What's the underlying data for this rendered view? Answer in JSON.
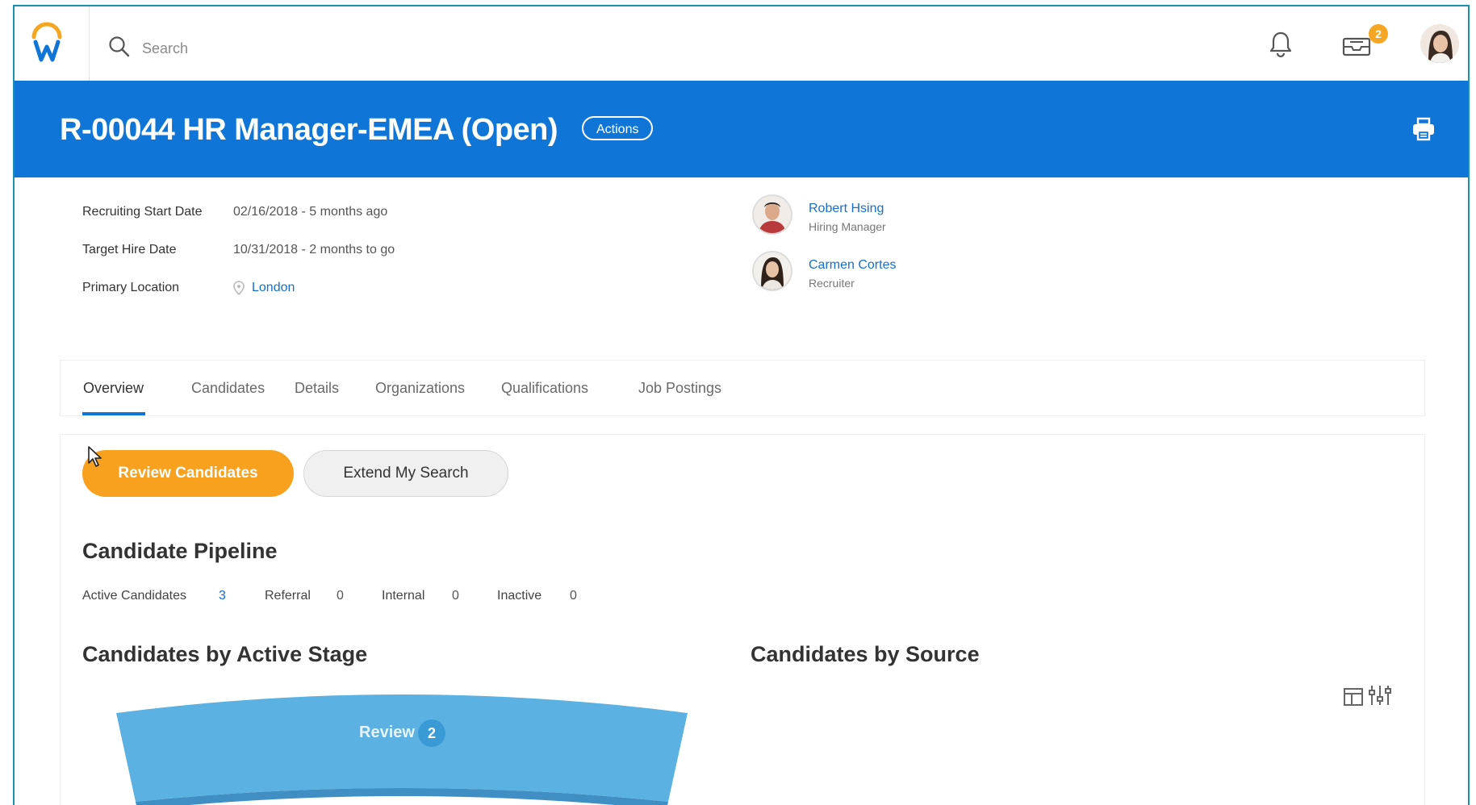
{
  "topbar": {
    "search_placeholder": "Search",
    "inbox_badge": "2"
  },
  "header": {
    "title": "R-00044 HR Manager-EMEA (Open)",
    "actions_label": "Actions"
  },
  "info": {
    "rows": [
      {
        "label": "Recruiting Start Date",
        "value": "02/16/2018 - 5 months ago"
      },
      {
        "label": "Target Hire Date",
        "value": "10/31/2018 - 2 months to go"
      },
      {
        "label": "Primary Location",
        "value": "London"
      }
    ],
    "people": [
      {
        "name": "Robert Hsing",
        "role": "Hiring Manager"
      },
      {
        "name": "Carmen Cortes",
        "role": "Recruiter"
      }
    ]
  },
  "tabs": [
    "Overview",
    "Candidates",
    "Details",
    "Organizations",
    "Qualifications",
    "Job Postings"
  ],
  "buttons": {
    "review": "Review Candidates",
    "extend": "Extend My Search"
  },
  "pipeline": {
    "title": "Candidate Pipeline",
    "stats": [
      {
        "label": "Active Candidates",
        "value": "3"
      },
      {
        "label": "Referral",
        "value": "0"
      },
      {
        "label": "Internal",
        "value": "0"
      },
      {
        "label": "Inactive",
        "value": "0"
      }
    ]
  },
  "charts": {
    "stage_title": "Candidates by Active Stage",
    "source_title": "Candidates by Source",
    "stage": {
      "label": "Review",
      "count": "2"
    }
  },
  "colors": {
    "header_blue": "#0f76d7",
    "primary_orange": "#f7a11f",
    "link_blue": "#1670c9",
    "funnel_blue": "#5bb1e2"
  }
}
